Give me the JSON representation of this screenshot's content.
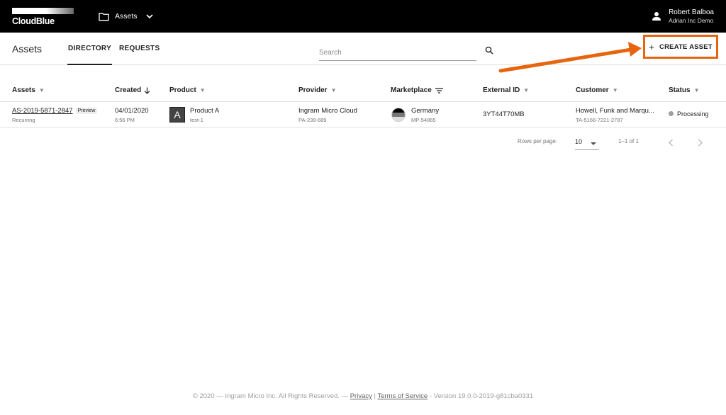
{
  "topbar": {
    "brand": "CloudBlue",
    "module_label": "Assets",
    "user_name": "Robert Balboa",
    "user_account": "Adrian Inc Demo"
  },
  "subnav": {
    "title": "Assets",
    "tabs": [
      {
        "label": "DIRECTORY",
        "active": true
      },
      {
        "label": "REQUESTS",
        "active": false
      }
    ],
    "search_placeholder": "Search",
    "create_label": "CREATE ASSET",
    "highlight_color": "#e8650f"
  },
  "table": {
    "columns": [
      "Assets",
      "Created",
      "Product",
      "Provider",
      "Marketplace",
      "External ID",
      "Customer",
      "Status"
    ],
    "rows": [
      {
        "asset_id": "AS-2019-5871-2847",
        "asset_badge": "Preview",
        "asset_type": "Recurring",
        "created_date": "04/01/2020",
        "created_time": "6:56 PM",
        "product_initial": "A",
        "product_name": "Product A",
        "product_sub": "test-1",
        "provider_name": "Ingram Micro Cloud",
        "provider_id": "PA-239-689",
        "marketplace_name": "Germany",
        "marketplace_id": "MP-54865",
        "external_id": "3YT44T70MB",
        "customer_name": "Howell, Funk and Marqu...",
        "customer_id": "TA-5166-7221-2787",
        "status": "Processing"
      }
    ]
  },
  "pagination": {
    "rows_per_page_label": "Rows per page:",
    "rows_per_page": "10",
    "range": "1–1 of 1"
  },
  "footer": {
    "copyright": "© 2020 — Ingram Micro Inc. All Rights Reserved. —",
    "privacy": "Privacy",
    "separator": "|",
    "terms": "Terms of Service",
    "version": "- Version 19.0.0-2019-g81cba0331"
  }
}
